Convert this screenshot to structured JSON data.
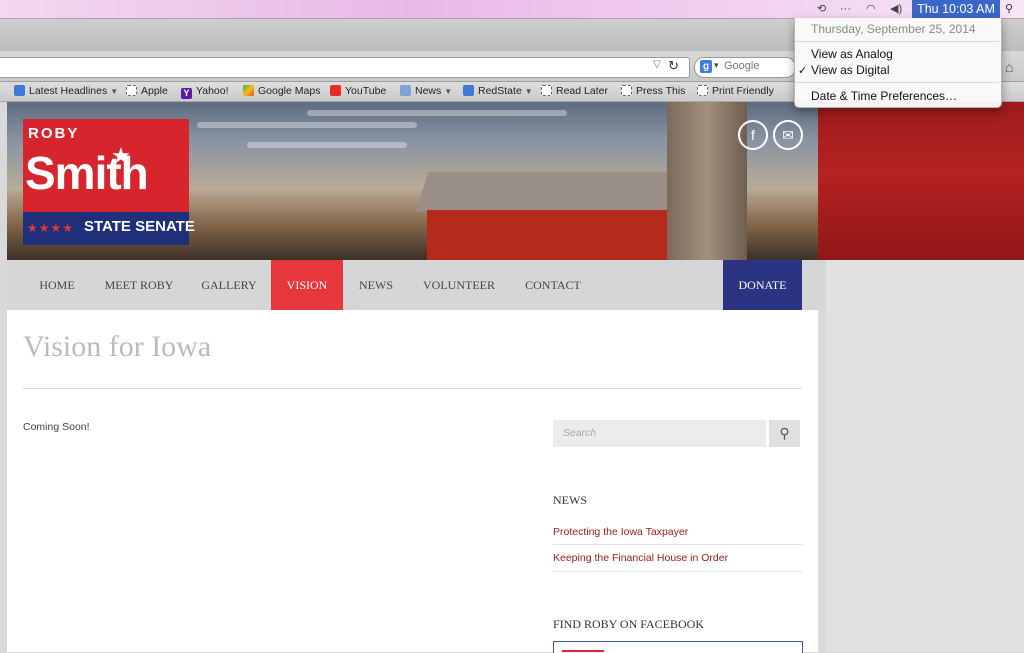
{
  "menubar": {
    "clock": "Thu 10:03 AM",
    "icons": [
      "time-machine-icon",
      "more-icon",
      "wifi-icon",
      "volume-icon",
      "spotlight-icon"
    ]
  },
  "clock_menu": {
    "date": "Thursday, September 25, 2014",
    "analog": "View as Analog",
    "digital": "View as Digital",
    "preferences": "Date & Time Preferences…"
  },
  "browser": {
    "search_placeholder": "Google",
    "bookmarks": [
      {
        "label": "Latest Headlines",
        "icon": "rss",
        "menu": true
      },
      {
        "label": "Apple",
        "icon": "doc",
        "menu": false
      },
      {
        "label": "Yahoo!",
        "icon": "yahoo",
        "menu": false
      },
      {
        "label": "Google Maps",
        "icon": "maps",
        "menu": false
      },
      {
        "label": "YouTube",
        "icon": "youtube",
        "menu": false
      },
      {
        "label": "News",
        "icon": "folder",
        "menu": true
      },
      {
        "label": "RedState",
        "icon": "rss",
        "menu": true
      },
      {
        "label": "Read Later",
        "icon": "doc",
        "menu": false
      },
      {
        "label": "Press This",
        "icon": "doc",
        "menu": false
      },
      {
        "label": "Print Friendly",
        "icon": "doc",
        "menu": false
      }
    ]
  },
  "site": {
    "logo": {
      "roby": "ROBY",
      "smith": "Smith",
      "senate": "STATE SENATE"
    },
    "nav": {
      "home": "HOME",
      "meet": "MEET ROBY",
      "gallery": "GALLERY",
      "vision": "VISION",
      "news": "NEWS",
      "volunteer": "VOLUNTEER",
      "contact": "CONTACT",
      "donate": "DONATE"
    },
    "page_title": "Vision for Iowa",
    "body_text": "Coming Soon!",
    "search_placeholder": "Search",
    "news_heading": "NEWS",
    "news_items": [
      "Protecting the Iowa Taxpayer",
      "Keeping the Financial House in Order"
    ],
    "facebook_heading": "FIND ROBY ON FACEBOOK"
  }
}
